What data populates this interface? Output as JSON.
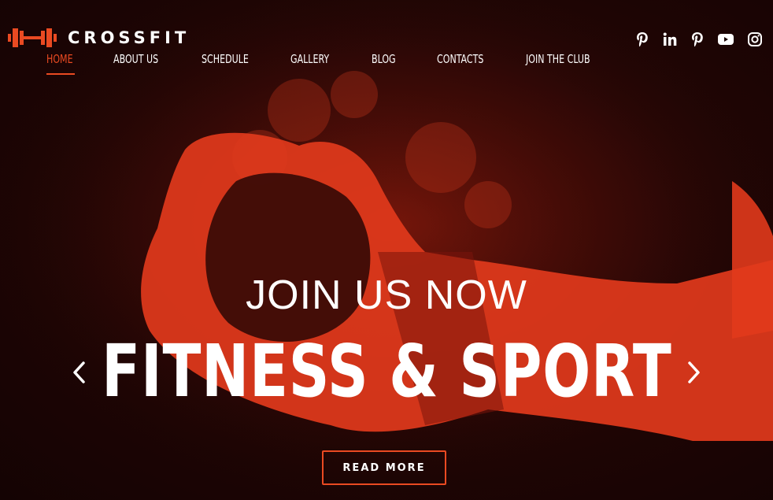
{
  "brand": {
    "name": "CROSSFIT",
    "icon": "barbell-icon",
    "accent": "#ea4a22"
  },
  "nav": {
    "items": [
      {
        "label": "HOME",
        "active": true
      },
      {
        "label": "ABOUT US",
        "active": false
      },
      {
        "label": "SCHEDULE",
        "active": false
      },
      {
        "label": "GALLERY",
        "active": false
      },
      {
        "label": "BLOG",
        "active": false
      },
      {
        "label": "CONTACTS",
        "active": false
      },
      {
        "label": "JOIN THE CLUB",
        "active": false
      }
    ]
  },
  "social": [
    "pinterest-icon",
    "linkedin-icon",
    "pinterest-icon",
    "youtube-icon",
    "instagram-icon"
  ],
  "hero": {
    "kicker": "JOIN US NOW",
    "headline": "FITNESS & SPORT",
    "cta_label": "READ MORE",
    "prev_icon": "chevron-left-icon",
    "next_icon": "chevron-right-icon"
  },
  "colors": {
    "background": "#1a0505",
    "accent": "#ea4a22",
    "text": "#ffffff"
  }
}
